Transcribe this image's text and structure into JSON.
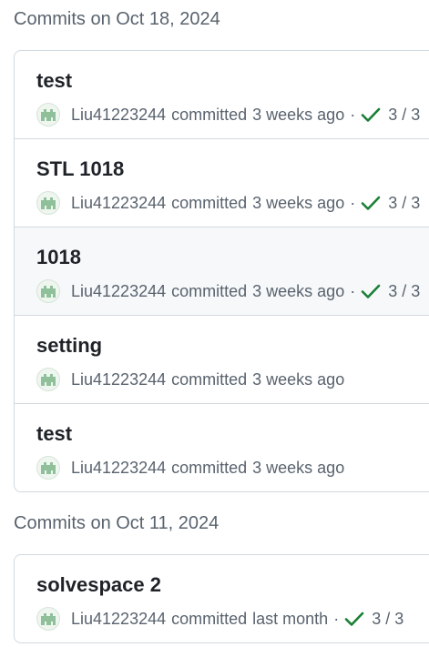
{
  "groups": [
    {
      "heading": "Commits on Oct 18, 2024",
      "commits": [
        {
          "title": "test",
          "author": "Liu41223244",
          "action": "committed",
          "time": "3 weeks ago",
          "separator": "·",
          "checks": "3 / 3"
        },
        {
          "title": "STL 1018",
          "author": "Liu41223244",
          "action": "committed",
          "time": "3 weeks ago",
          "separator": "·",
          "checks": "3 / 3"
        },
        {
          "title": "1018",
          "author": "Liu41223244",
          "action": "committed",
          "time": "3 weeks ago",
          "separator": "·",
          "checks": "3 / 3"
        },
        {
          "title": "setting",
          "author": "Liu41223244",
          "action": "committed",
          "time": "3 weeks ago"
        },
        {
          "title": "test",
          "author": "Liu41223244",
          "action": "committed",
          "time": "3 weeks ago"
        }
      ]
    },
    {
      "heading": "Commits on Oct 11, 2024",
      "commits": [
        {
          "title": "solvespace 2",
          "author": "Liu41223244",
          "action": "committed",
          "time": "last month",
          "separator": "·",
          "checks": "3 / 3"
        }
      ]
    }
  ],
  "icons": {
    "avatar": "identicon-avatar",
    "check": "check-icon"
  },
  "colors": {
    "check": "#1a7f37",
    "avatar": "#8fc09a",
    "highlight_row": "#f6f8fa"
  }
}
